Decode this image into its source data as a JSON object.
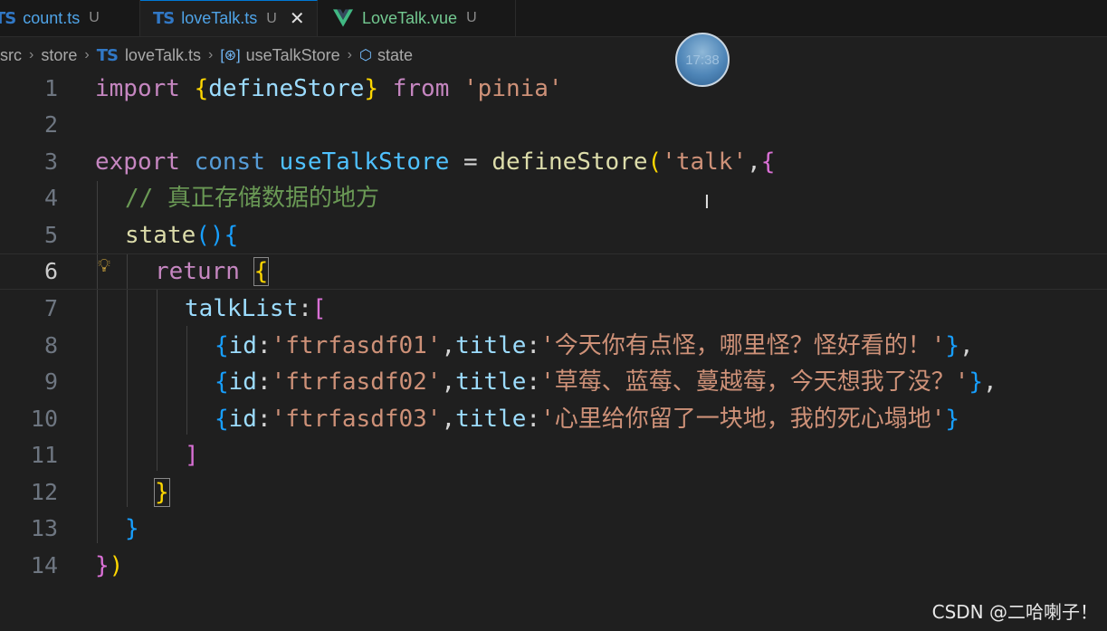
{
  "tabs": [
    {
      "icon": "TS",
      "name": "count.ts",
      "status": "U"
    },
    {
      "icon": "TS",
      "name": "loveTalk.ts",
      "status": "U",
      "close": "✕"
    },
    {
      "icon": "vue-icon",
      "name": "LoveTalk.vue",
      "status": "U"
    }
  ],
  "breadcrumb": {
    "items": [
      "src",
      "store",
      "loveTalk.ts",
      "useTalkStore",
      "state"
    ],
    "ts_icon": "TS"
  },
  "clock_time": "17:38",
  "code": {
    "line_numbers": [
      "1",
      "2",
      "3",
      "4",
      "5",
      "6",
      "7",
      "8",
      "9",
      "10",
      "11",
      "12",
      "13",
      "14"
    ],
    "current_line": 6,
    "l1": {
      "import": "import",
      "ob": "{",
      "name": "defineStore",
      "cb": "}",
      "from": "from",
      "mod": "'pinia'"
    },
    "l3": {
      "export": "export",
      "const": "const",
      "name": "useTalkStore",
      "eq": " = ",
      "fn": "defineStore",
      "op": "(",
      "arg": "'talk'",
      "comma": ",",
      "ob": "{"
    },
    "l4": {
      "comment": "// 真正存储数据的地方"
    },
    "l5": {
      "fn": "state",
      "op": "()",
      "ob": "{"
    },
    "l6": {
      "ret": "return",
      "ob": "{"
    },
    "l7": {
      "key": "talkList",
      "colon": ":",
      "ob": "["
    },
    "items": [
      {
        "id_key": "id",
        "id": "'ftrfasdf01'",
        "title_key": "title",
        "title": "'今天你有点怪，哪里怪？怪好看的！'",
        "tail": ","
      },
      {
        "id_key": "id",
        "id": "'ftrfasdf02'",
        "title_key": "title",
        "title": "'草莓、蓝莓、蔓越莓，今天想我了没？'",
        "tail": ","
      },
      {
        "id_key": "id",
        "id": "'ftrfasdf03'",
        "title_key": "title",
        "title": "'心里给你留了一块地，我的死心塌地'",
        "tail": ""
      }
    ],
    "l11": {
      "cb": "]"
    },
    "l12": {
      "cb": "}"
    },
    "l13": {
      "cb": "}"
    },
    "l14": {
      "cb": "}",
      "cp": ")"
    }
  },
  "watermark": "CSDN @二哈喇子！",
  "colors": {
    "keyword": "#569cd6",
    "control": "#c586c0",
    "function": "#dcdcaa",
    "variable": "#9cdcfe",
    "string": "#ce9178",
    "comment": "#6a9955"
  }
}
